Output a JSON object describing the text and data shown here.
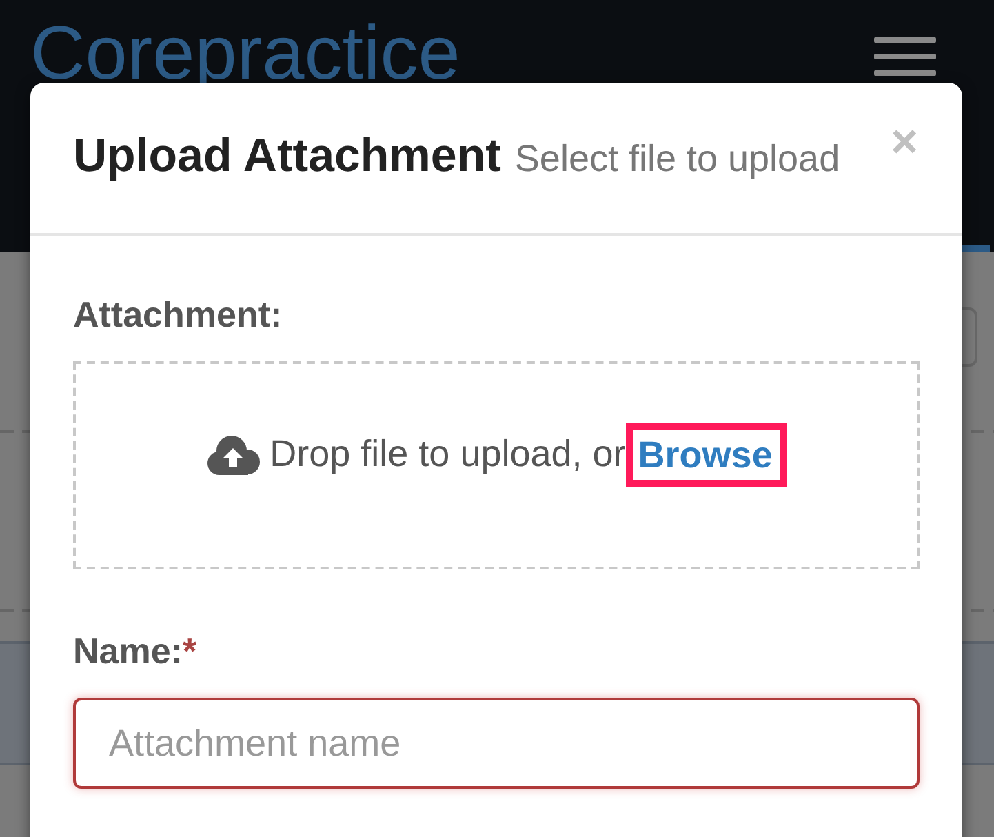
{
  "header": {
    "logo": "Corepractice"
  },
  "modal": {
    "title": "Upload Attachment",
    "subtitle": "Select file to upload",
    "close": "×",
    "fields": [
      {
        "kind": "dropzone",
        "label": "Attachment:",
        "prompt": "Drop file to upload, or",
        "link": {
          "text": "Browse",
          "highlighted": true
        }
      },
      {
        "kind": "text",
        "label": "Name:",
        "required_mark": "*",
        "placeholder": "Attachment name",
        "invalid": true
      }
    ]
  }
}
